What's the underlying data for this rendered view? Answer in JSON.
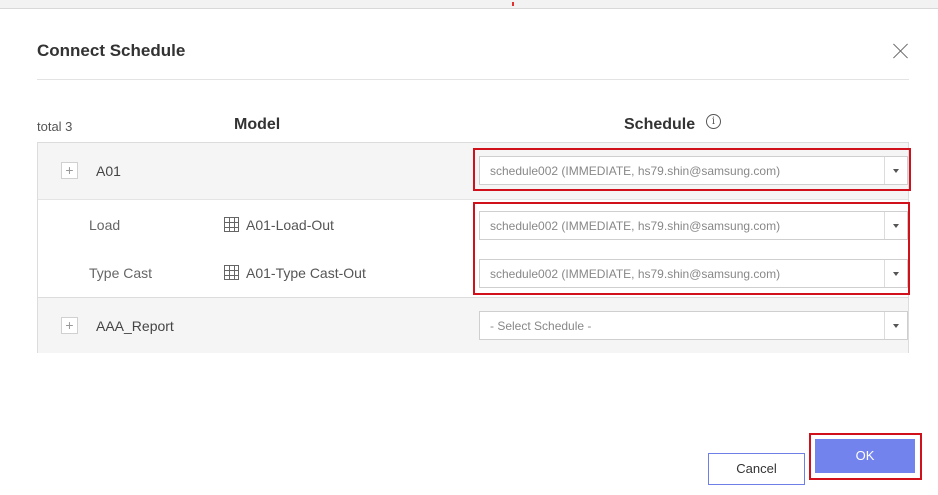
{
  "dialog": {
    "title": "Connect Schedule",
    "close_icon": "close-icon"
  },
  "table": {
    "total_label": "total 3",
    "col_model": "Model",
    "col_schedule": "Schedule",
    "info_icon": "info-icon",
    "info_glyph": "i",
    "rows": [
      {
        "expand_glyph": "+",
        "name": "A01",
        "schedule": "schedule002 (IMMEDIATE, hs79.shin@samsung.com)",
        "children": [
          {
            "name": "Load",
            "model": "A01-Load-Out",
            "model_icon": "table-grid-icon",
            "schedule": "schedule002 (IMMEDIATE, hs79.shin@samsung.com)"
          },
          {
            "name": "Type Cast",
            "model": "A01-Type Cast-Out",
            "model_icon": "table-grid-icon",
            "schedule": "schedule002 (IMMEDIATE, hs79.shin@samsung.com)"
          }
        ]
      },
      {
        "expand_glyph": "+",
        "name": "AAA_Report",
        "schedule": "- Select Schedule -"
      }
    ]
  },
  "footer": {
    "cancel_label": "Cancel",
    "ok_label": "OK"
  },
  "colors": {
    "highlight": "#d0111b",
    "ok_button": "#7383ee",
    "cancel_border": "#6f7fe8"
  }
}
